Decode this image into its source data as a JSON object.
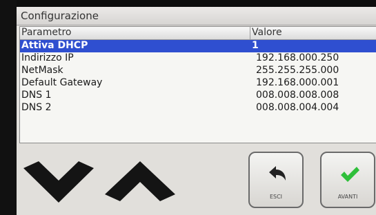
{
  "window": {
    "title": "Configurazione"
  },
  "table": {
    "headers": {
      "param": "Parametro",
      "value": "Valore"
    },
    "rows": [
      {
        "param": "Attiva DHCP",
        "value": "1"
      },
      {
        "param": "Indirizzo IP",
        "value": "192.168.000.250"
      },
      {
        "param": "NetMask",
        "value": "255.255.255.000"
      },
      {
        "param": "Default Gateway",
        "value": "192.168.000.001"
      },
      {
        "param": "DNS 1",
        "value": "008.008.008.008"
      },
      {
        "param": "DNS 2",
        "value": "008.008.004.004"
      }
    ],
    "selected_row": "Attiva DHCP"
  },
  "buttons": {
    "down": {
      "icon": "chevron-down-icon"
    },
    "up": {
      "icon": "chevron-up-icon"
    },
    "esci": {
      "label": "ESCI",
      "icon": "back-arrow-icon"
    },
    "avanti": {
      "label": "AVANTI",
      "icon": "checkmark-icon"
    }
  },
  "colors": {
    "selection": "#2f4fd0",
    "check": "#2fbf3a"
  }
}
